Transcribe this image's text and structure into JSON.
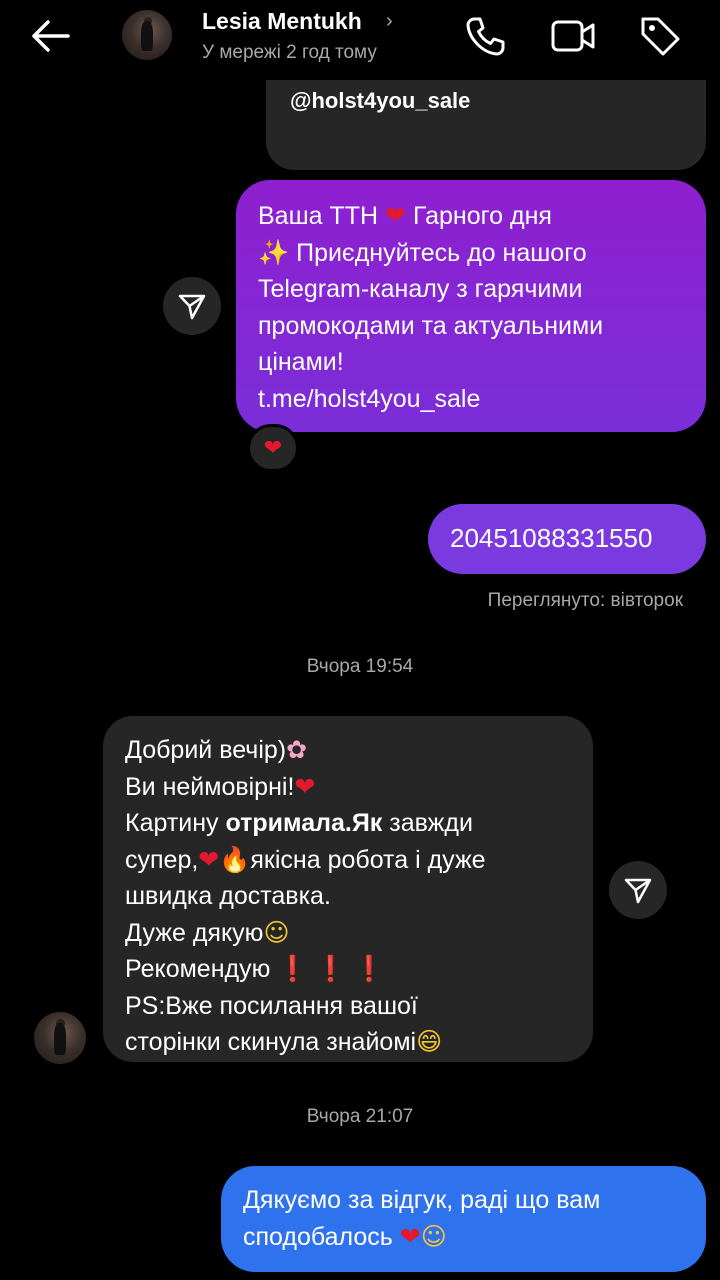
{
  "header": {
    "contact_name": "Lesia Mentukh",
    "status": "У мережі 2 год тому",
    "icons": [
      "back-arrow-icon",
      "phone-icon",
      "video-camera-icon",
      "tag-icon"
    ]
  },
  "messages": {
    "quoted": {
      "text": "@holst4you_sale"
    },
    "tth": {
      "lines": [
        "Ваша ТТН",
        "Гарного дня",
        "Приєднуйтесь до нашого",
        "Telegram-каналу з гарячими",
        "промокодами та актуальними",
        "цінами!",
        "t.me/holst4you_sale"
      ],
      "emoji": {
        "heart": "❤",
        "sparkle": "✨"
      }
    },
    "reaction": "❤",
    "number": {
      "text": "20451088331550"
    },
    "seen": "Переглянуто: вівторок",
    "time1": "Вчора 19:54",
    "review": {
      "lines": [
        "Добрий вечір)",
        "Ви неймовірні!",
        "Картину",
        "отримала.Як",
        "завжди",
        "супер,",
        "якісна робота і дуже",
        "швидка доставка.",
        "Дуже дякую",
        "Рекомендую",
        "PS:Вже посилання вашої",
        "сторінки скинула знайомі"
      ],
      "emoji": {
        "blossom": "✿",
        "heart": "❤",
        "fire": "🔥",
        "smile": "☺",
        "bang": "❗",
        "grin": "😄"
      }
    },
    "time2": "Вчора 21:07",
    "thanks": {
      "lines": [
        "Дякуємо за відгук, раді що вам",
        "сподобалось"
      ],
      "emoji": {
        "heart": "❤",
        "smile": "☺"
      }
    }
  },
  "colors": {
    "background": "#000000",
    "incoming_bubble": "#262626",
    "outgoing_purple": "#8f1fd0",
    "outgoing_violet": "#7b3ae0",
    "outgoing_blue": "#2f72ee",
    "secondary_text": "#a8a8a8"
  }
}
